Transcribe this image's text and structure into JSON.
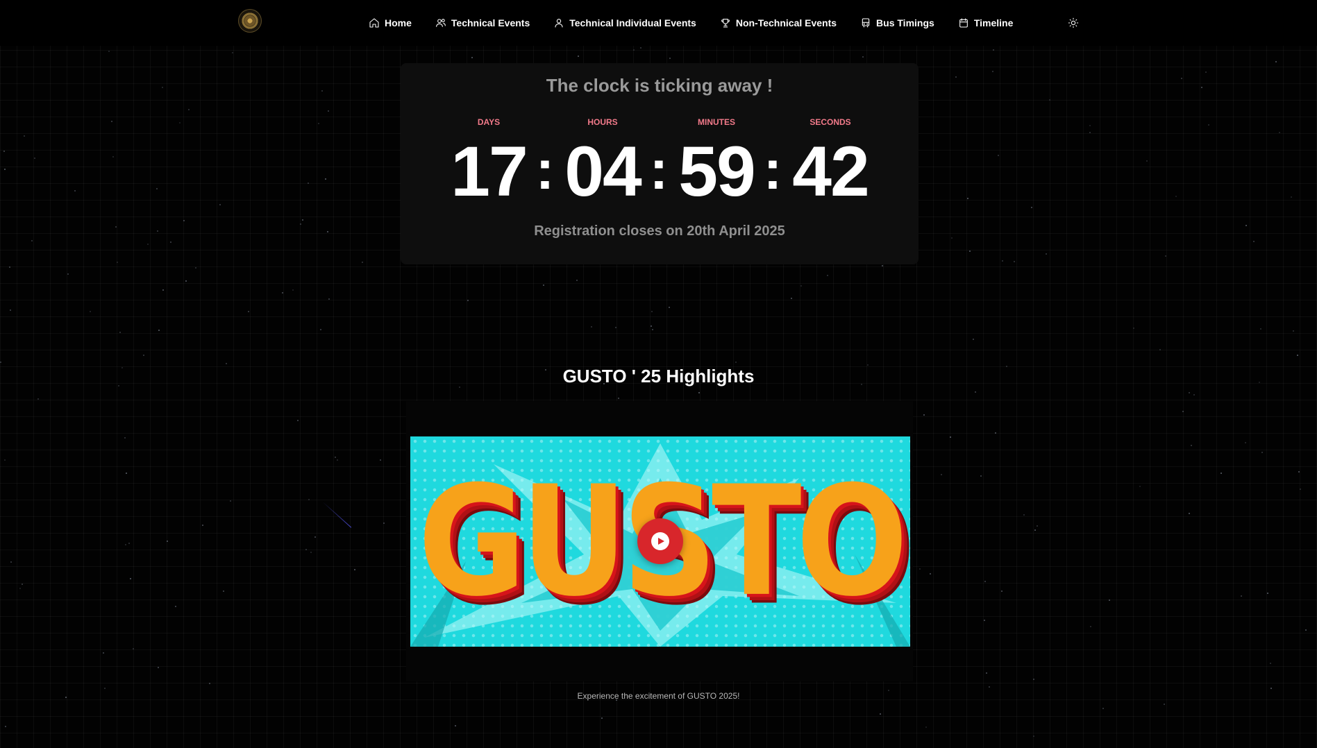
{
  "navbar": {
    "items": [
      {
        "label": "Home",
        "icon": "home-icon"
      },
      {
        "label": "Technical Events",
        "icon": "users-icon"
      },
      {
        "label": "Technical Individual Events",
        "icon": "user-icon"
      },
      {
        "label": "Non-Technical Events",
        "icon": "trophy-icon"
      },
      {
        "label": "Bus Timings",
        "icon": "bus-icon"
      },
      {
        "label": "Timeline",
        "icon": "calendar-icon"
      }
    ],
    "theme_toggle_icon": "sun-icon",
    "logo_icon": "emblem-logo"
  },
  "countdown": {
    "heading": "The clock is ticking away !",
    "units": [
      {
        "label": "DAYS",
        "value": "17"
      },
      {
        "label": "HOURS",
        "value": "04"
      },
      {
        "label": "MINUTES",
        "value": "59"
      },
      {
        "label": "SECONDS",
        "value": "42"
      }
    ],
    "separator": ":",
    "note": "Registration closes on 20th April 2025"
  },
  "highlights": {
    "title": "GUSTO ' 25 Highlights",
    "thumbnail_text": "GUSTO",
    "play_icon": "play-icon",
    "caption": "Experience the excitement of GUSTO 2025!"
  },
  "colors": {
    "background": "#020202",
    "unit_label": "#f27a8a",
    "play_button": "#d8262b",
    "thumbnail_bg": "#1fd9de"
  }
}
